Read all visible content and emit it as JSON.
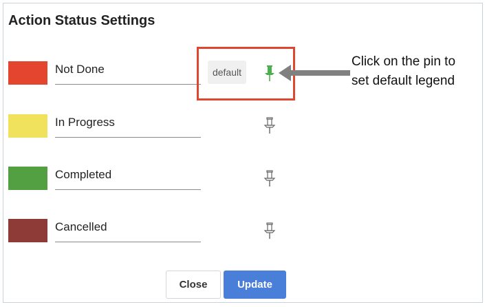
{
  "dialog": {
    "title": "Action Status Settings",
    "close_label": "Close",
    "update_label": "Update"
  },
  "statuses": [
    {
      "label": "Not Done",
      "color": "#e3452f",
      "is_default": true,
      "default_badge": "default",
      "pin_color": "#4caf50"
    },
    {
      "label": "In Progress",
      "color": "#f0e25c",
      "is_default": false,
      "pin_color": "#666666"
    },
    {
      "label": "Completed",
      "color": "#53a043",
      "is_default": false,
      "pin_color": "#666666"
    },
    {
      "label": "Cancelled",
      "color": "#8e3b37",
      "is_default": false,
      "pin_color": "#666666"
    }
  ],
  "annotation": {
    "line1": "Click on the pin to",
    "line2": "set default legend",
    "highlight_color": "#e0462f",
    "arrow_color": "#808080"
  }
}
